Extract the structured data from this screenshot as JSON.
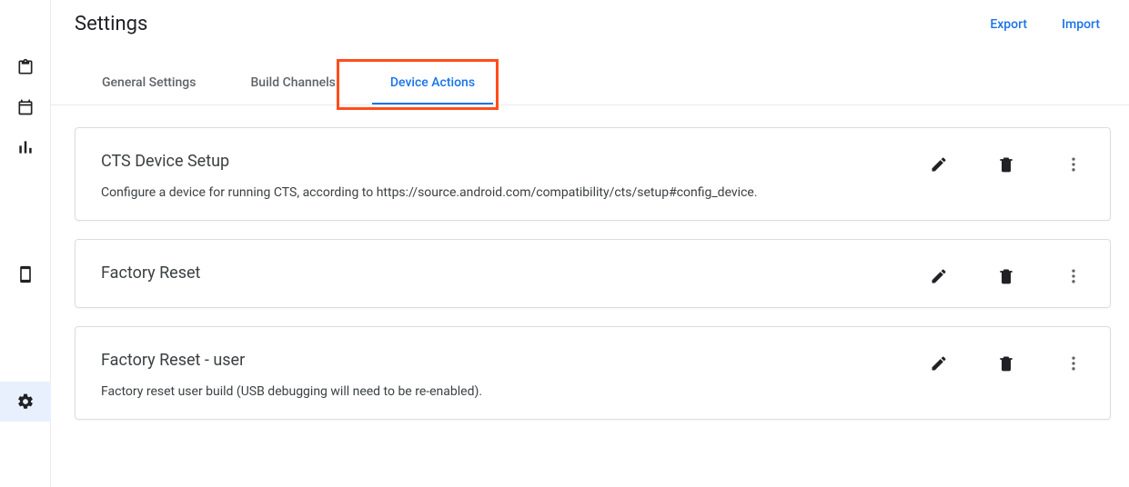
{
  "header": {
    "title": "Settings",
    "export": "Export",
    "import": "Import"
  },
  "tabs": [
    {
      "label": "General Settings"
    },
    {
      "label": "Build Channels"
    },
    {
      "label": "Device Actions"
    }
  ],
  "activeTab": 2,
  "actions": [
    {
      "title": "CTS Device Setup",
      "description": "Configure a device for running CTS, according to https://source.android.com/compatibility/cts/setup#config_device."
    },
    {
      "title": "Factory Reset",
      "description": ""
    },
    {
      "title": "Factory Reset - user",
      "description": "Factory reset user build (USB debugging will need to be re-enabled)."
    }
  ],
  "sidebar": {
    "items": [
      "clipboard",
      "calendar",
      "chart",
      "device",
      "settings"
    ],
    "activeIndex": 4
  }
}
